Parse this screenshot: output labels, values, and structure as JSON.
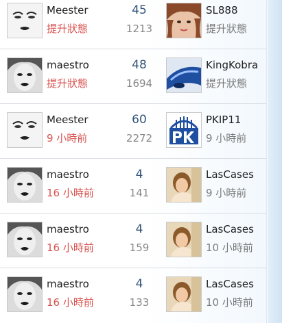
{
  "matches": [
    {
      "player1": {
        "name": "Meester",
        "status": "提升狀態",
        "avatar": "avatar-meester-icon"
      },
      "score": "45",
      "count": "1213",
      "player2": {
        "name": "SL888",
        "status": "提升狀態",
        "avatar": "avatar-sl888-icon"
      }
    },
    {
      "player1": {
        "name": "maestro",
        "status": "提升狀態",
        "avatar": "avatar-maestro-icon"
      },
      "score": "48",
      "count": "1694",
      "player2": {
        "name": "KingKobra",
        "status": "提升狀態",
        "avatar": "avatar-kingkobra-icon"
      }
    },
    {
      "player1": {
        "name": "Meester",
        "status": "9 小時前",
        "avatar": "avatar-meester-icon"
      },
      "score": "60",
      "count": "2272",
      "player2": {
        "name": "PKIP11",
        "status": "9 小時前",
        "avatar": "avatar-pkip11-icon"
      }
    },
    {
      "player1": {
        "name": "maestro",
        "status": "16 小時前",
        "avatar": "avatar-maestro-icon"
      },
      "score": "4",
      "count": "141",
      "player2": {
        "name": "LasCases",
        "status": "9 小時前",
        "avatar": "avatar-lascases-icon"
      }
    },
    {
      "player1": {
        "name": "maestro",
        "status": "16 小時前",
        "avatar": "avatar-maestro-icon"
      },
      "score": "4",
      "count": "159",
      "player2": {
        "name": "LasCases",
        "status": "10 小時前",
        "avatar": "avatar-lascases-icon"
      }
    },
    {
      "player1": {
        "name": "maestro",
        "status": "16 小時前",
        "avatar": "avatar-maestro-icon"
      },
      "score": "4",
      "count": "133",
      "player2": {
        "name": "LasCases",
        "status": "10 小時前",
        "avatar": "avatar-lascases-icon"
      }
    }
  ],
  "colors": {
    "status_recent": "#d9534f",
    "status_muted": "#7a7a7a",
    "score": "#33557a",
    "count": "#888888"
  }
}
